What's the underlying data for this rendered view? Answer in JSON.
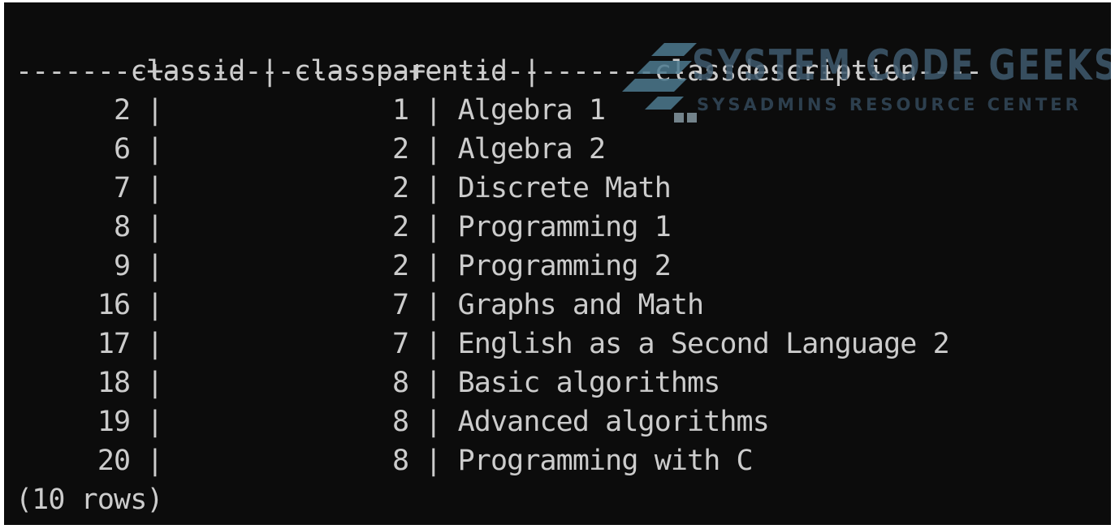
{
  "table": {
    "headers": [
      " classid ",
      " classparentid ",
      "       classdescription"
    ],
    "separator": "--------+---------------+----------------------------------",
    "rows": [
      {
        "classid": "2",
        "classparentid": "1",
        "classdescription": "Algebra 1"
      },
      {
        "classid": "6",
        "classparentid": "2",
        "classdescription": "Algebra 2"
      },
      {
        "classid": "7",
        "classparentid": "2",
        "classdescription": "Discrete Math"
      },
      {
        "classid": "8",
        "classparentid": "2",
        "classdescription": "Programming 1"
      },
      {
        "classid": "9",
        "classparentid": "2",
        "classdescription": "Programming 2"
      },
      {
        "classid": "16",
        "classparentid": "7",
        "classdescription": "Graphs and Math"
      },
      {
        "classid": "17",
        "classparentid": "7",
        "classdescription": "English as a Second Language 2"
      },
      {
        "classid": "18",
        "classparentid": "8",
        "classdescription": "Basic algorithms"
      },
      {
        "classid": "19",
        "classparentid": "8",
        "classdescription": "Advanced algorithms"
      },
      {
        "classid": "20",
        "classparentid": "8",
        "classdescription": "Programming with C"
      }
    ],
    "footer": "(10 rows)"
  },
  "watermark": {
    "title": "SYSTEM CODE GEEKS",
    "subtitle": "SYSADMINS RESOURCE CENTER"
  },
  "colors": {
    "terminal_background": "#0c0c0c",
    "terminal_text": "#cccccc",
    "watermark_text": "#3f5a6e",
    "watermark_logo": "#4d7a8f"
  }
}
